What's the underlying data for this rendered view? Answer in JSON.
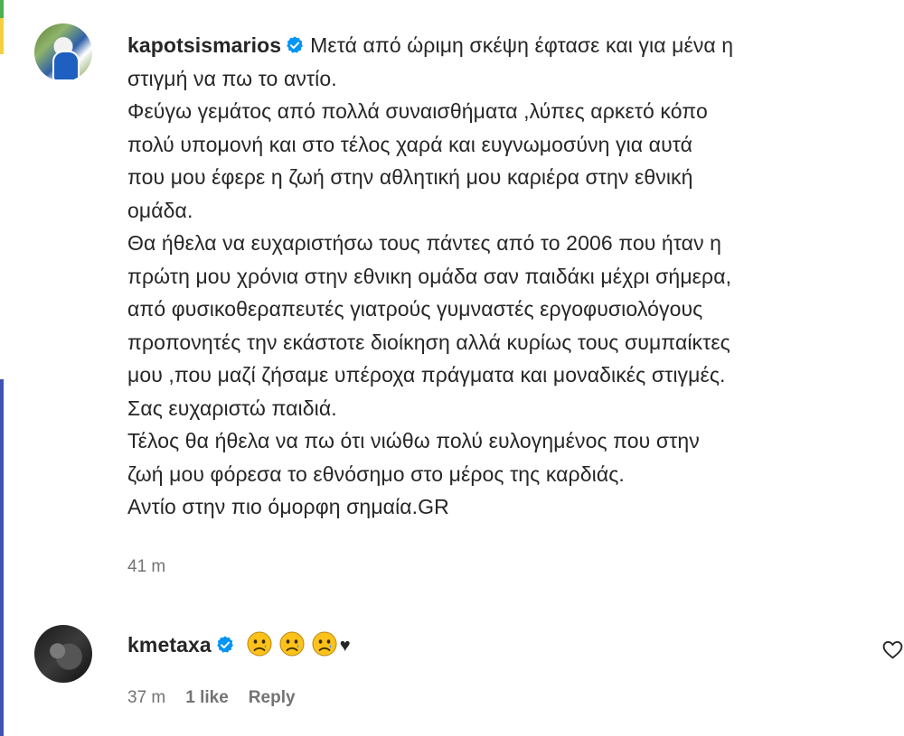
{
  "comments": [
    {
      "username": "kapotsismarios",
      "verified": true,
      "lines": [
        "Μετά από ώριμη σκέψη έφτασε και για μένα η",
        "στιγμή να πω το αντίο.",
        "Φεύγω γεμάτος από πολλά συναισθήματα ,λύπες αρκετό κόπο",
        "πολύ υπομονή και στο τέλος χαρά και ευγνωμοσύνη για αυτά",
        "που μου έφερε η ζωή στην αθλητική μου καριέρα στην εθνική",
        "ομάδα.",
        "Θα ήθελα να ευχαριστήσω τους πάντες από το 2006 που ήταν η",
        "πρώτη μου χρόνια στην εθνικη ομάδα σαν παιδάκι μέχρι σήμερα,",
        "από φυσικοθεραπευτές γιατρούς γυμναστές εργοφυσιολόγους",
        "προπονητές την εκάστοτε διοίκηση αλλά κυρίως τους συμπαίκτες",
        "μου ,που μαζί ζήσαμε υπέροχα πράγματα και μοναδικές στιγμές.",
        "Σας ευχαριστώ παιδιά.",
        "Τέλος θα ήθελα να πω ότι νιώθω πολύ ευλογημένος που στην",
        "ζωή μου φόρεσα το εθνόσημο στο μέρος της καρδιάς.",
        "Αντίο στην πιο όμορφη σημαία.GR"
      ],
      "time": "41 m"
    },
    {
      "username": "kmetaxa",
      "verified": true,
      "emoji": [
        "crying-face",
        "crying-face",
        "crying-face"
      ],
      "heart": "♥",
      "time": "37 m",
      "likes": "1 like",
      "reply_label": "Reply"
    }
  ],
  "colors": {
    "verified_blue": "#0095f6",
    "meta_gray": "#737373",
    "text": "#262626"
  }
}
